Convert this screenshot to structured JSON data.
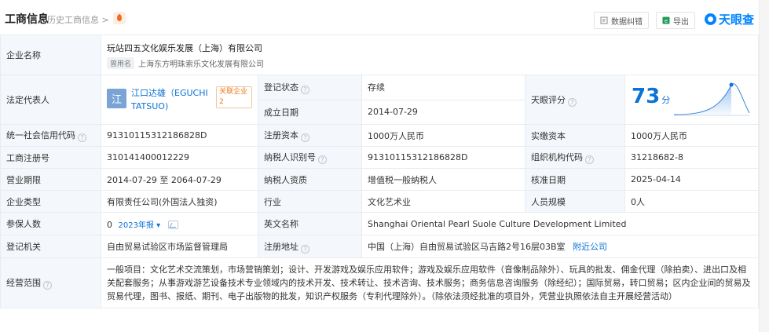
{
  "header": {
    "title": "工商信息",
    "history": "历史工商信息",
    "error_btn": "数据纠错",
    "export_btn": "导出",
    "logo": "天眼查"
  },
  "company": {
    "label": "企业名称",
    "name": "玩站四五文化娱乐发展（上海）有限公司",
    "former_tag": "曾用名",
    "former_name": "上海东方明珠索乐文化发展有限公司"
  },
  "rep": {
    "label": "法定代表人",
    "avatar_char": "江",
    "name": "江口达雄（EGUCHI TATSUO)",
    "related": "关联企业 2"
  },
  "status": {
    "label": "登记状态",
    "value": "存续"
  },
  "founded": {
    "label": "成立日期",
    "value": "2014-07-29"
  },
  "score": {
    "label": "天眼评分",
    "value": "73",
    "unit": "分"
  },
  "rows": {
    "credit_code": {
      "label": "统一社会信用代码",
      "value": "91310115312186828D"
    },
    "reg_capital": {
      "label": "注册资本",
      "value": "1000万人民币"
    },
    "paid_capital": {
      "label": "实缴资本",
      "value": "1000万人民币"
    },
    "reg_no": {
      "label": "工商注册号",
      "value": "310141400012229"
    },
    "tax_id": {
      "label": "纳税人识别号",
      "value": "91310115312186828D"
    },
    "org_code": {
      "label": "组织机构代码",
      "value": "31218682-8"
    },
    "term": {
      "label": "营业期限",
      "value": "2014-07-29 至 2064-07-29"
    },
    "taxpayer_type": {
      "label": "纳税人资质",
      "value": "增值税一般纳税人"
    },
    "approval_date": {
      "label": "核准日期",
      "value": "2025-04-14"
    },
    "company_type": {
      "label": "企业类型",
      "value": "有限责任公司(外国法人独资)"
    },
    "industry": {
      "label": "行业",
      "value": "文化艺术业"
    },
    "staff_size": {
      "label": "人员规模",
      "value": "0人"
    },
    "insured": {
      "label": "参保人数",
      "value": "0",
      "year": "2023年报"
    },
    "english_name": {
      "label": "英文名称",
      "value": "Shanghai Oriental Pearl Suole Culture Development Limited"
    },
    "authority": {
      "label": "登记机关",
      "value": "自由贸易试验区市场监督管理局"
    },
    "address": {
      "label": "注册地址",
      "value": "中国（上海）自由贸易试验区马吉路2号16层03B室",
      "nearby": "附近公司"
    },
    "scope": {
      "label": "经营范围",
      "value": "一般项目：文化艺术交流策划，市场营销策划；设计、开发游戏及娱乐应用软件；游戏及娱乐应用软件（音像制品除外）、玩具的批发、佣金代理（除拍卖）、进出口及相关配套服务；从事游戏游艺设备技术专业领域内的技术开发、技术转让、技术咨询、技术服务；商务信息咨询服务（除经纪）；国际贸易，转口贸易；区内企业间的贸易及贸易代理，图书、报纸、期刊、电子出版物的批发，知识产权服务（专利代理除外）。（除依法须经批准的项目外，凭营业执照依法自主开展经营活动）"
    }
  }
}
